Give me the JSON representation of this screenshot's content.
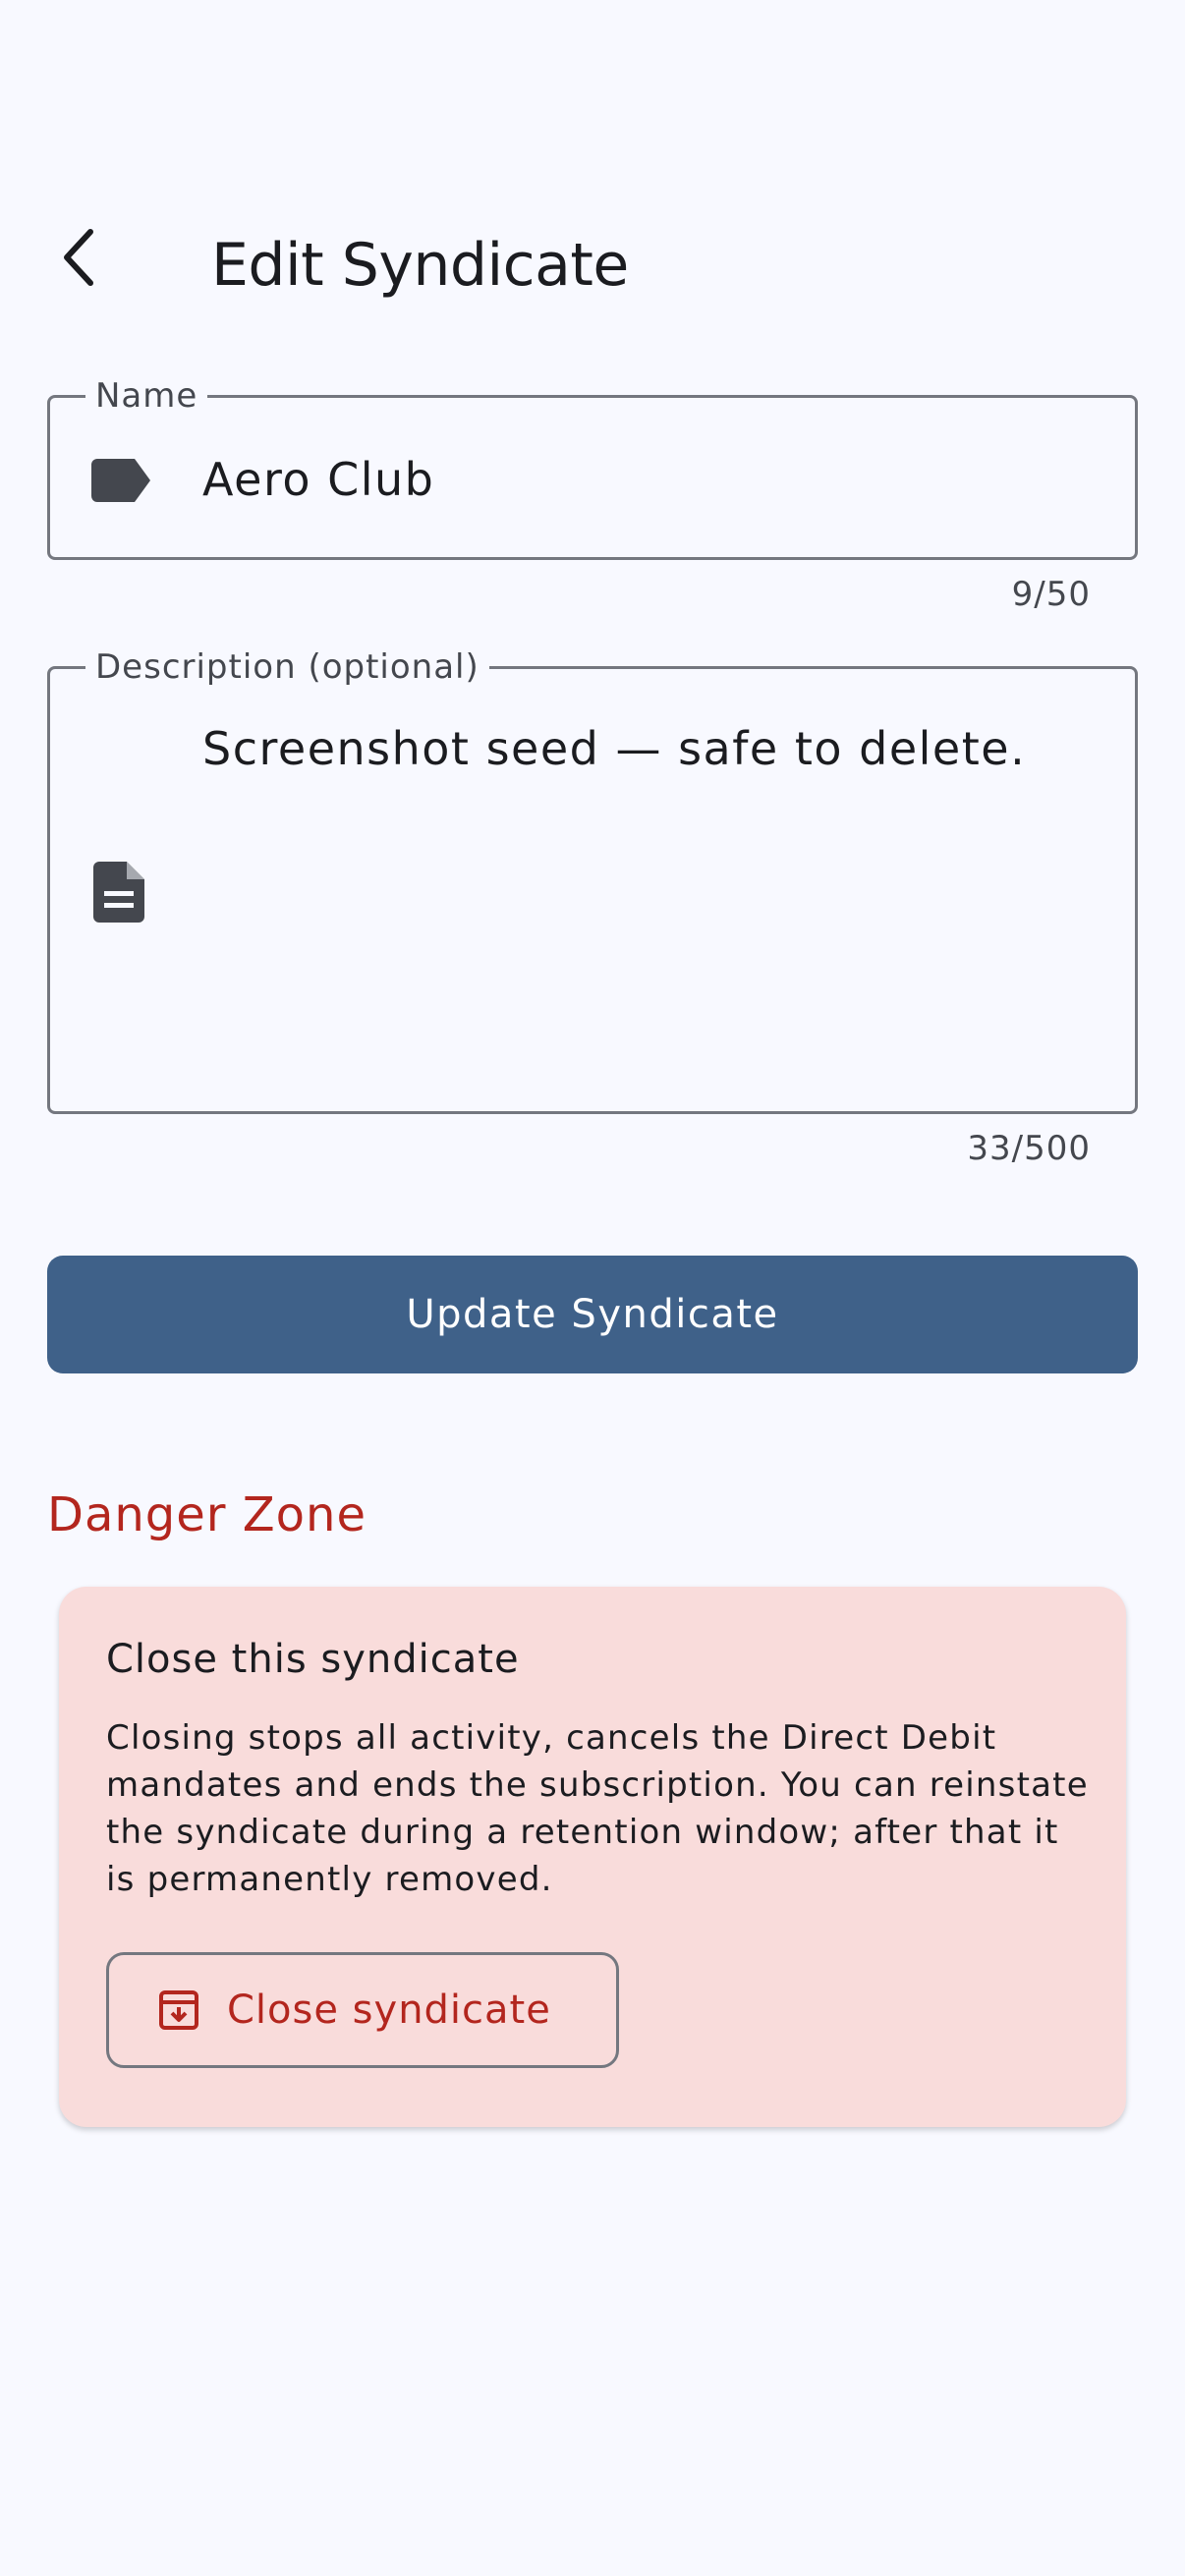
{
  "header": {
    "title": "Edit Syndicate",
    "back_icon": "back-arrow-icon"
  },
  "form": {
    "name": {
      "label": "Name",
      "value": "Aero Club",
      "counter": "9/50",
      "icon": "label-tag-icon"
    },
    "description": {
      "label": "Description (optional)",
      "value": "Screenshot seed — safe to delete.",
      "counter": "33/500",
      "icon": "document-icon"
    },
    "submit_label": "Update Syndicate"
  },
  "danger_zone": {
    "heading": "Danger Zone",
    "card": {
      "title": "Close this syndicate",
      "body": "Closing stops all activity, cancels the Direct Debit mandates and ends the subscription. You can reinstate the syndicate during a retention window; after that it is permanently removed.",
      "button_label": "Close syndicate",
      "button_icon": "archive-icon"
    }
  },
  "colors": {
    "background": "#f8f9ff",
    "primary": "#3f6189",
    "danger": "#b3261e",
    "danger_container": "#f9dcdb",
    "outline": "#74777f"
  }
}
